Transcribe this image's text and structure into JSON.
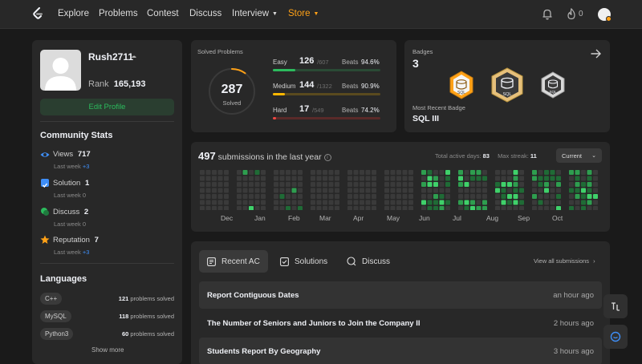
{
  "nav": {
    "items": [
      "Explore",
      "Problems",
      "Contest",
      "Discuss",
      "Interview",
      "Store"
    ],
    "notifications_count": "0"
  },
  "profile": {
    "username": "Rush2711",
    "rank_label": "Rank",
    "rank_value": "165,193",
    "edit_button": "Edit Profile"
  },
  "community": {
    "title": "Community Stats",
    "stats": [
      {
        "label": "Views",
        "value": "717",
        "sub_label": "Last week",
        "sub_value": "+3",
        "icon": "eye-icon",
        "color": "#3e8ef7"
      },
      {
        "label": "Solution",
        "value": "1",
        "sub_label": "Last week",
        "sub_value": "0",
        "icon": "check-square-icon",
        "color": "#3e8ef7"
      },
      {
        "label": "Discuss",
        "value": "2",
        "sub_label": "Last week",
        "sub_value": "0",
        "icon": "discuss-icon",
        "color": "#2cbb5d"
      },
      {
        "label": "Reputation",
        "value": "7",
        "sub_label": "Last week",
        "sub_value": "+3",
        "icon": "star-icon",
        "color": "#ffa116"
      }
    ]
  },
  "languages": {
    "title": "Languages",
    "items": [
      {
        "name": "C++",
        "count": "121",
        "suffix": "problems solved"
      },
      {
        "name": "MySQL",
        "count": "118",
        "suffix": "problems solved"
      },
      {
        "name": "Python3",
        "count": "60",
        "suffix": "problems solved"
      }
    ],
    "show_more": "Show more"
  },
  "solved": {
    "title": "Solved Problems",
    "total": "287",
    "total_label": "Solved",
    "ring_fraction": 0.1,
    "levels": [
      {
        "name": "Easy",
        "solved": "126",
        "total": "/607",
        "beats_label": "Beats",
        "beats": "94.6%",
        "fraction": 0.2076,
        "color": "#2cbb5d",
        "bg": "#2a4a35"
      },
      {
        "name": "Medium",
        "solved": "144",
        "total": "/1322",
        "beats_label": "Beats",
        "beats": "90.9%",
        "fraction": 0.1089,
        "color": "#ffb800",
        "bg": "#5a4a1f"
      },
      {
        "name": "Hard",
        "solved": "17",
        "total": "/549",
        "beats_label": "Beats",
        "beats": "74.2%",
        "fraction": 0.031,
        "color": "#ef4743",
        "bg": "#5a2a29"
      }
    ]
  },
  "badges": {
    "title": "Badges",
    "count": "3",
    "recent_label": "Most Recent Badge",
    "recent_name": "SQL III",
    "badge_text": "SQL"
  },
  "calendar": {
    "count": "497",
    "label": "submissions in the last year",
    "active_label": "Total active days:",
    "active_value": "83",
    "streak_label": "Max streak:",
    "streak_value": "11",
    "dropdown": "Current",
    "months": [
      "Dec",
      "Jan",
      "Feb",
      "Mar",
      "Apr",
      "May",
      "Jun",
      "Jul",
      "Aug",
      "Sep",
      "Oct"
    ]
  },
  "tabs": [
    {
      "label": "Recent AC",
      "icon": "list-icon"
    },
    {
      "label": "Solutions",
      "icon": "check-box-icon"
    },
    {
      "label": "Discuss",
      "icon": "chat-icon"
    }
  ],
  "view_all": "View all submissions",
  "submissions": [
    {
      "title": "Report Contiguous Dates",
      "time": "an hour ago"
    },
    {
      "title": "The Number of Seniors and Juniors to Join the Company II",
      "time": "2 hours ago"
    },
    {
      "title": "Students Report By Geography",
      "time": "3 hours ago"
    }
  ]
}
